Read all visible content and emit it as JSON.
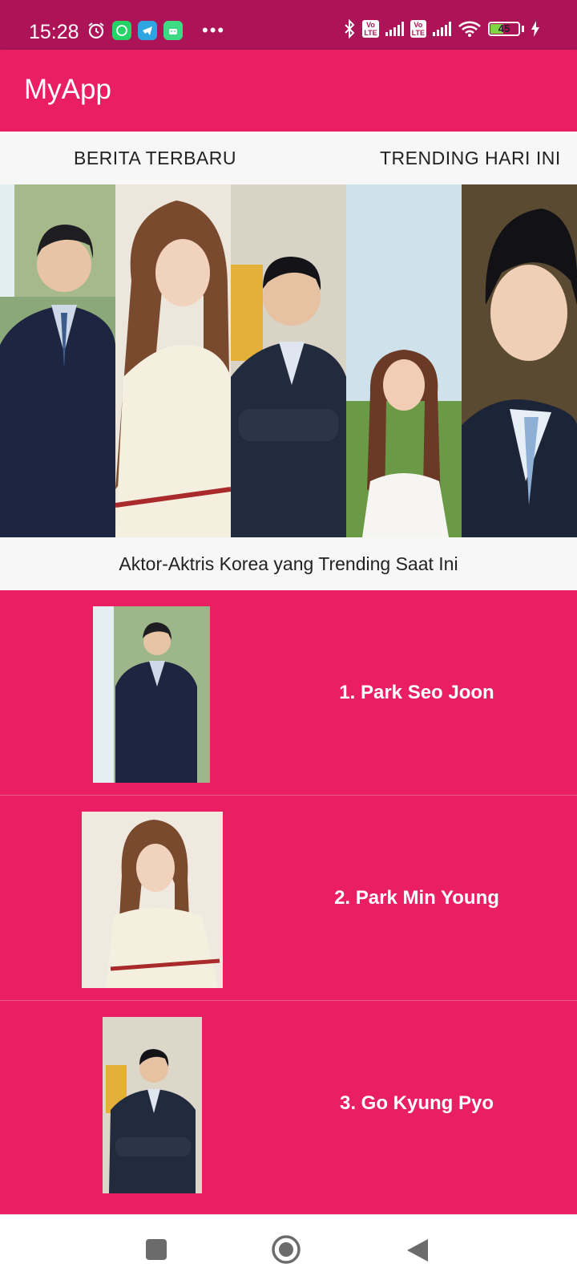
{
  "status_bar": {
    "time": "15:28",
    "battery_level": "45",
    "volte_label": "Vo LTE",
    "icons": [
      "alarm-icon",
      "whatsapp-icon",
      "telegram-icon",
      "android-icon",
      "more-dots-icon",
      "bluetooth-icon",
      "volte-icon",
      "signal-icon",
      "wifi-icon",
      "battery-icon",
      "charging-icon"
    ]
  },
  "app_bar": {
    "title": "MyApp"
  },
  "tabs": [
    {
      "label": "BERITA TERBARU"
    },
    {
      "label": "TRENDING HARI INI"
    }
  ],
  "banner": {
    "caption": "Aktor-Aktris Korea yang Trending Saat Ini"
  },
  "list": {
    "items": [
      {
        "label": "1. Park Seo Joon"
      },
      {
        "label": "2. Park Min Young"
      },
      {
        "label": "3. Go Kyung Pyo"
      }
    ]
  },
  "nav": {
    "icons": [
      "recent-apps-icon",
      "home-icon",
      "back-icon"
    ]
  },
  "colors": {
    "status_bar": "#ad1457",
    "primary": "#e91e63",
    "tab_background": "#f7f7f7"
  }
}
